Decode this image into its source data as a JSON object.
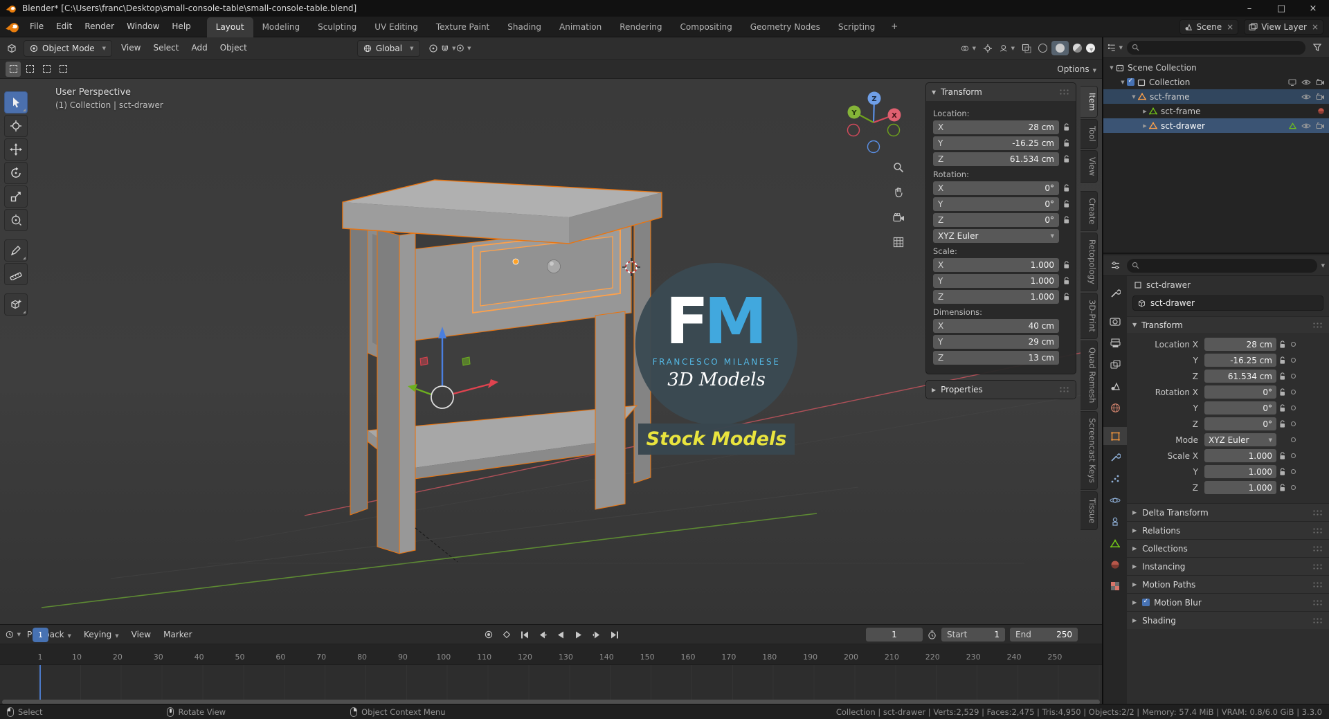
{
  "titlebar": {
    "title": "Blender* [C:\\Users\\franc\\Desktop\\small-console-table\\small-console-table.blend]",
    "minimize": "–",
    "maximize": "□",
    "close": "×"
  },
  "menubar": {
    "menus": [
      "File",
      "Edit",
      "Render",
      "Window",
      "Help"
    ],
    "workspaces": [
      {
        "label": "Layout",
        "cls": "active"
      },
      {
        "label": "Modeling",
        "cls": ""
      },
      {
        "label": "Sculpting",
        "cls": ""
      },
      {
        "label": "UV Editing",
        "cls": ""
      },
      {
        "label": "Texture Paint",
        "cls": ""
      },
      {
        "label": "Shading",
        "cls": ""
      },
      {
        "label": "Animation",
        "cls": ""
      },
      {
        "label": "Rendering",
        "cls": ""
      },
      {
        "label": "Compositing",
        "cls": ""
      },
      {
        "label": "Geometry Nodes",
        "cls": ""
      },
      {
        "label": "Scripting",
        "cls": ""
      }
    ],
    "add_tab": "+",
    "scene": {
      "label": "Scene",
      "clear": "×"
    },
    "view_layer": {
      "label": "View Layer",
      "clear": "×"
    }
  },
  "viewport_header": {
    "mode": "Object Mode",
    "menus": [
      "View",
      "Select",
      "Add",
      "Object"
    ],
    "orientation": "Global",
    "options": "Options"
  },
  "left_toolbar_tools": [
    "select-box",
    "cursor",
    "move",
    "rotate",
    "scale",
    "transform",
    "annotate",
    "measure",
    "add-cube"
  ],
  "viewport": {
    "view_label": "User Perspective",
    "context_label": "(1) Collection | sct-drawer",
    "axis_x": "X",
    "axis_y": "Y",
    "axis_z": "Z",
    "watermark": {
      "f": "F",
      "m": "M",
      "name": "FRANCESCO MILANESE",
      "line": "3D Models",
      "banner": "Stock Models"
    }
  },
  "n_panel": {
    "tabs": [
      {
        "label": "Item",
        "cls": "active"
      },
      {
        "label": "Tool",
        "cls": ""
      },
      {
        "label": "View",
        "cls": ""
      },
      {
        "label": "Create",
        "cls": "grp"
      },
      {
        "label": "Retopology",
        "cls": ""
      },
      {
        "label": "3D-Print",
        "cls": ""
      },
      {
        "label": "Quad Remesh",
        "cls": ""
      },
      {
        "label": "Screencast Keys",
        "cls": ""
      },
      {
        "label": "Tissue",
        "cls": ""
      }
    ],
    "transform_title": "Transform",
    "location_label": "Location:",
    "loc_x_key": "X",
    "loc_x": "28 cm",
    "loc_y_key": "Y",
    "loc_y": "-16.25 cm",
    "loc_z_key": "Z",
    "loc_z": "61.534 cm",
    "rotation_label": "Rotation:",
    "rot_x_key": "X",
    "rot_x": "0°",
    "rot_y_key": "Y",
    "rot_y": "0°",
    "rot_z_key": "Z",
    "rot_z": "0°",
    "euler": "XYZ Euler",
    "scale_label": "Scale:",
    "scl_x_key": "X",
    "scl_x": "1.000",
    "scl_y_key": "Y",
    "scl_y": "1.000",
    "scl_z_key": "Z",
    "scl_z": "1.000",
    "dimensions_label": "Dimensions:",
    "dim_x_key": "X",
    "dim_x": "40 cm",
    "dim_y_key": "Y",
    "dim_y": "29 cm",
    "dim_z_key": "Z",
    "dim_z": "13 cm",
    "properties_label": "Properties"
  },
  "outliner": {
    "rows": [
      {
        "label": "Scene Collection"
      },
      {
        "label": "Collection"
      },
      {
        "label": "sct-frame"
      },
      {
        "label": "sct-frame"
      },
      {
        "label": "sct-drawer"
      }
    ]
  },
  "properties": {
    "breadcrumb": "sct-drawer",
    "object_name": "sct-drawer",
    "transform_title": "Transform",
    "rows": [
      {
        "label": "Location X",
        "value": "28 cm",
        "cls": ""
      },
      {
        "label": "Y",
        "value": "-16.25 cm",
        "cls": ""
      },
      {
        "label": "Z",
        "value": "61.534 cm",
        "cls": ""
      },
      {
        "label": "Rotation X",
        "value": "0°",
        "cls": ""
      },
      {
        "label": "Y",
        "value": "0°",
        "cls": ""
      },
      {
        "label": "Z",
        "value": "0°",
        "cls": ""
      },
      {
        "label": "Mode",
        "value": "XYZ Euler",
        "cls": "mode"
      },
      {
        "label": "Scale X",
        "value": "1.000",
        "cls": ""
      },
      {
        "label": "Y",
        "value": "1.000",
        "cls": ""
      },
      {
        "label": "Z",
        "value": "1.000",
        "cls": ""
      }
    ],
    "sections": [
      {
        "label": "Delta Transform",
        "cls": ""
      },
      {
        "label": "Relations",
        "cls": ""
      },
      {
        "label": "Collections",
        "cls": ""
      },
      {
        "label": "Instancing",
        "cls": ""
      },
      {
        "label": "Motion Paths",
        "cls": ""
      },
      {
        "label": "Motion Blur",
        "cls": "checked"
      },
      {
        "label": "Shading",
        "cls": ""
      }
    ],
    "tab_icons": [
      "tool",
      "render",
      "output",
      "view-layer",
      "scene",
      "world",
      "object",
      "modifiers",
      "particles",
      "physics",
      "constraints",
      "object-data",
      "material",
      "texture"
    ]
  },
  "timeline": {
    "menus": [
      {
        "label": "Playback",
        "cls": "dd"
      },
      {
        "label": "Keying",
        "cls": "dd"
      },
      {
        "label": "View",
        "cls": ""
      },
      {
        "label": "Marker",
        "cls": ""
      }
    ],
    "current_frame": "1",
    "frame_value": "1",
    "start_label": "Start",
    "start_value": "1",
    "end_label": "End",
    "end_value": "250",
    "ticks": [
      "1",
      "10",
      "20",
      "30",
      "40",
      "50",
      "60",
      "70",
      "80",
      "90",
      "100",
      "110",
      "120",
      "130",
      "140",
      "150",
      "160",
      "170",
      "180",
      "190",
      "200",
      "210",
      "220",
      "230",
      "240",
      "250"
    ]
  },
  "statusbar": {
    "hints": [
      {
        "label": "Select",
        "cls": "mouse-left"
      },
      {
        "label": "Rotate View",
        "cls": "mouse-middle"
      },
      {
        "label": "Object Context Menu",
        "cls": "mouse-right"
      }
    ],
    "stats": "Collection | sct-drawer | Verts:2,529 | Faces:2,475 | Tris:4,950 | Objects:2/2 | Memory: 57.4 MiB | VRAM: 0.8/6.0 GiB | 3.3.0"
  },
  "colors": {
    "accent": "#4772b3",
    "select_orange": "#e87d0d",
    "active_orange": "#ff9a3c",
    "axis_x": "#c4485b",
    "axis_y": "#6fa21c",
    "axis_z": "#3b6fd2",
    "watermark_blue": "#41a8de",
    "stock_yellow": "#e9e43e"
  }
}
